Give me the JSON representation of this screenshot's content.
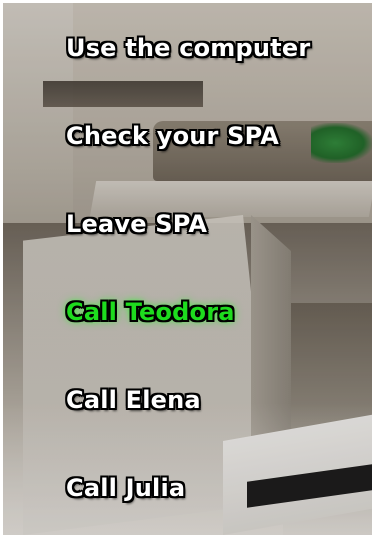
{
  "menu": {
    "choices": [
      {
        "label": "Use the computer",
        "selected": false
      },
      {
        "label": "Check your SPA",
        "selected": false
      },
      {
        "label": "Leave SPA",
        "selected": false
      },
      {
        "label": "Call Teodora",
        "selected": true
      },
      {
        "label": "Call Elena",
        "selected": false
      },
      {
        "label": "Call Julia",
        "selected": false
      }
    ]
  },
  "colors": {
    "choice_text": "#ffffff",
    "selected_text": "#1edc1e",
    "outline": "#000000"
  }
}
